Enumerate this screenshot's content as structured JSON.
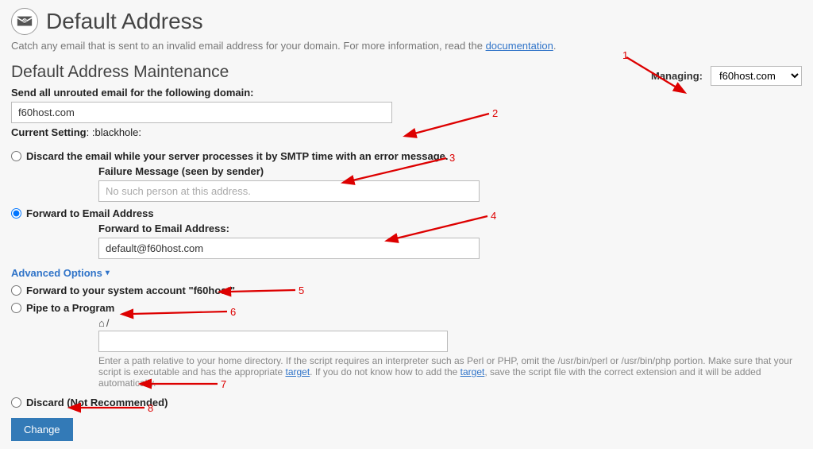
{
  "header": {
    "title": "Default Address"
  },
  "intro": {
    "text": "Catch any email that is sent to an invalid email address for your domain. For more information, read the ",
    "link": "documentation",
    "after": "."
  },
  "managing": {
    "label": "Managing:",
    "selected": "f60host.com"
  },
  "maintenance": {
    "heading": "Default Address Maintenance",
    "domain_label": "Send all unrouted email for the following domain:",
    "domain_value": "f60host.com",
    "current_setting_label": "Current Setting",
    "current_setting_value": ":blackhole:"
  },
  "options": {
    "discard": {
      "label": "Discard the email while your server processes it by SMTP time with an error message.",
      "failure_label": "Failure Message (seen by sender)",
      "failure_placeholder": "No such person at this address."
    },
    "forward_email": {
      "label": "Forward to Email Address",
      "field_label": "Forward to Email Address:",
      "value": "default@f60host.com"
    }
  },
  "advanced": {
    "toggle": "Advanced Options",
    "forward_system": {
      "prefix": "Forward to your system account ",
      "account": "\"f60host\""
    },
    "pipe": {
      "label": "Pipe to a Program",
      "help_1": "Enter a path relative to your home directory. If the script requires an interpreter such as Perl or PHP, omit the /usr/bin/perl or /usr/bin/php portion. Make sure that your script is executable and has the appropriate ",
      "help_link1": "target",
      "help_2": ". If you do not know how to add the ",
      "help_link2": "target",
      "help_3": ", save the script file with the correct extension and it will be added automatically."
    },
    "discard_bad": {
      "label": "Discard (Not Recommended)"
    }
  },
  "submit": {
    "label": "Change"
  },
  "annotations": {
    "a1": "1",
    "a2": "2",
    "a3": "3",
    "a4": "4",
    "a5": "5",
    "a6": "6",
    "a7": "7",
    "a8": "8"
  }
}
